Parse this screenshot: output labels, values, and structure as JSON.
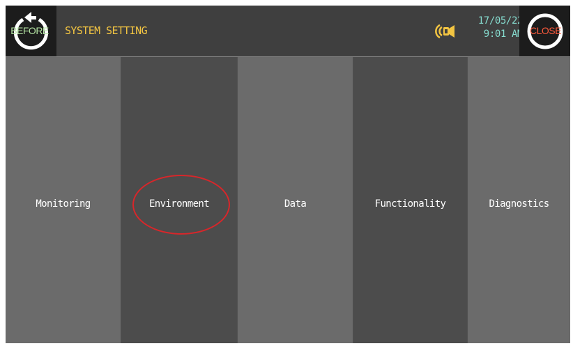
{
  "header": {
    "title": "SYSTEM SETTING",
    "before_label": "BEFORE",
    "close_label": "CLOSE",
    "date": "17/05/22",
    "time": "9:01 AM"
  },
  "menu": {
    "tiles": [
      {
        "label": "Monitoring"
      },
      {
        "label": "Environment"
      },
      {
        "label": "Data"
      },
      {
        "label": "Functionality"
      },
      {
        "label": "Diagnostics"
      }
    ]
  },
  "colors": {
    "title": "#f3c542",
    "datetime": "#86dccf",
    "before_label": "#b6e6a4",
    "close_label": "#ff5a3c",
    "highlight": "#d8262a"
  },
  "icons": {
    "before": "back-arrow-circle-icon",
    "close": "close-circle-icon",
    "speaker": "speaker-icon"
  },
  "annotation": {
    "highlighted_tile": "Environment"
  }
}
